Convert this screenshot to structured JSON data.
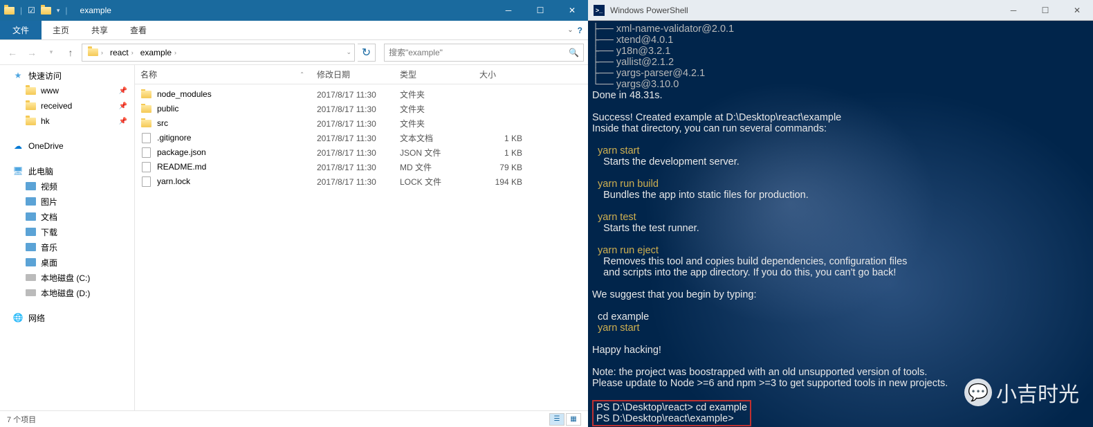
{
  "explorer": {
    "title": "example",
    "ribbon": {
      "file": "文件",
      "tabs": [
        "主页",
        "共享",
        "查看"
      ]
    },
    "breadcrumb": [
      "react",
      "example"
    ],
    "search_placeholder": "搜索\"example\"",
    "sidebar": {
      "quick_access": "快速访问",
      "qa_items": [
        {
          "label": "www",
          "pinned": true
        },
        {
          "label": "received",
          "pinned": true
        },
        {
          "label": "hk",
          "pinned": true
        }
      ],
      "onedrive": "OneDrive",
      "this_pc": "此电脑",
      "pc_items": [
        "视频",
        "图片",
        "文档",
        "下载",
        "音乐",
        "桌面",
        "本地磁盘 (C:)",
        "本地磁盘 (D:)"
      ],
      "network": "网络"
    },
    "columns": {
      "name": "名称",
      "date": "修改日期",
      "type": "类型",
      "size": "大小"
    },
    "files": [
      {
        "name": "node_modules",
        "date": "2017/8/17 11:30",
        "type": "文件夹",
        "size": "",
        "icon": "folder"
      },
      {
        "name": "public",
        "date": "2017/8/17 11:30",
        "type": "文件夹",
        "size": "",
        "icon": "folder"
      },
      {
        "name": "src",
        "date": "2017/8/17 11:30",
        "type": "文件夹",
        "size": "",
        "icon": "folder"
      },
      {
        "name": ".gitignore",
        "date": "2017/8/17 11:30",
        "type": "文本文档",
        "size": "1 KB",
        "icon": "file"
      },
      {
        "name": "package.json",
        "date": "2017/8/17 11:30",
        "type": "JSON 文件",
        "size": "1 KB",
        "icon": "file"
      },
      {
        "name": "README.md",
        "date": "2017/8/17 11:30",
        "type": "MD 文件",
        "size": "79 KB",
        "icon": "file"
      },
      {
        "name": "yarn.lock",
        "date": "2017/8/17 11:30",
        "type": "LOCK 文件",
        "size": "194 KB",
        "icon": "file"
      }
    ],
    "status": "7 个项目"
  },
  "powershell": {
    "title": "Windows PowerShell",
    "lines": [
      {
        "t": "tree",
        "text": "├── xml-name-validator@2.0.1"
      },
      {
        "t": "tree",
        "text": "├── xtend@4.0.1"
      },
      {
        "t": "tree",
        "text": "├── y18n@3.2.1"
      },
      {
        "t": "tree",
        "text": "├── yallist@2.1.2"
      },
      {
        "t": "tree",
        "text": "├── yargs-parser@4.2.1"
      },
      {
        "t": "tree",
        "text": "└── yargs@3.10.0"
      },
      {
        "t": "white",
        "text": "Done in 48.31s."
      },
      {
        "t": "white",
        "text": ""
      },
      {
        "t": "white",
        "text": "Success! Created example at D:\\Desktop\\react\\example"
      },
      {
        "t": "white",
        "text": "Inside that directory, you can run several commands:"
      },
      {
        "t": "white",
        "text": ""
      },
      {
        "t": "cmd",
        "text": "  yarn start"
      },
      {
        "t": "white",
        "text": "    Starts the development server."
      },
      {
        "t": "white",
        "text": ""
      },
      {
        "t": "cmd",
        "text": "  yarn run build"
      },
      {
        "t": "white",
        "text": "    Bundles the app into static files for production."
      },
      {
        "t": "white",
        "text": ""
      },
      {
        "t": "cmd",
        "text": "  yarn test"
      },
      {
        "t": "white",
        "text": "    Starts the test runner."
      },
      {
        "t": "white",
        "text": ""
      },
      {
        "t": "cmd",
        "text": "  yarn run eject"
      },
      {
        "t": "white",
        "text": "    Removes this tool and copies build dependencies, configuration files"
      },
      {
        "t": "white",
        "text": "    and scripts into the app directory. If you do this, you can't go back!"
      },
      {
        "t": "white",
        "text": ""
      },
      {
        "t": "white",
        "text": "We suggest that you begin by typing:"
      },
      {
        "t": "white",
        "text": ""
      },
      {
        "t": "white",
        "text": "  cd example"
      },
      {
        "t": "cmd",
        "text": "  yarn start"
      },
      {
        "t": "white",
        "text": ""
      },
      {
        "t": "white",
        "text": "Happy hacking!"
      },
      {
        "t": "white",
        "text": ""
      },
      {
        "t": "white",
        "text": "Note: the project was boostrapped with an old unsupported version of tools."
      },
      {
        "t": "white",
        "text": "Please update to Node >=6 and npm >=3 to get supported tools in new projects."
      },
      {
        "t": "white",
        "text": ""
      }
    ],
    "prompt1": "PS D:\\Desktop\\react> cd example",
    "prompt2": "PS D:\\Desktop\\react\\example>",
    "watermark_text": "小吉时光"
  }
}
